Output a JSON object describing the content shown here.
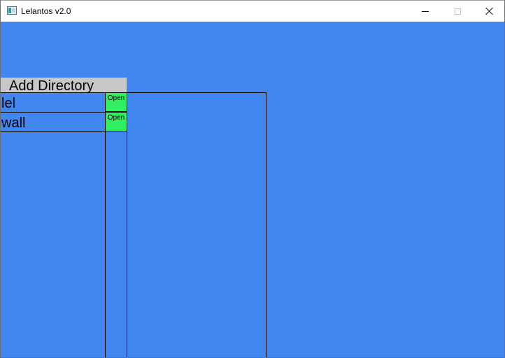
{
  "window": {
    "title": "Lelantos v2.0",
    "icon": "app-window-icon",
    "controls": [
      "minimize-icon",
      "maximize-icon",
      "close-icon"
    ],
    "background_color": "#4287f0"
  },
  "toolbar": {
    "add_directory_label": "Add Directory",
    "add_directory_color": "#c8c8c8"
  },
  "directories": [
    {
      "name": "lel",
      "open_label": "Open"
    },
    {
      "name": "wall",
      "open_label": "Open"
    }
  ],
  "open_button_color": "#2ef060"
}
